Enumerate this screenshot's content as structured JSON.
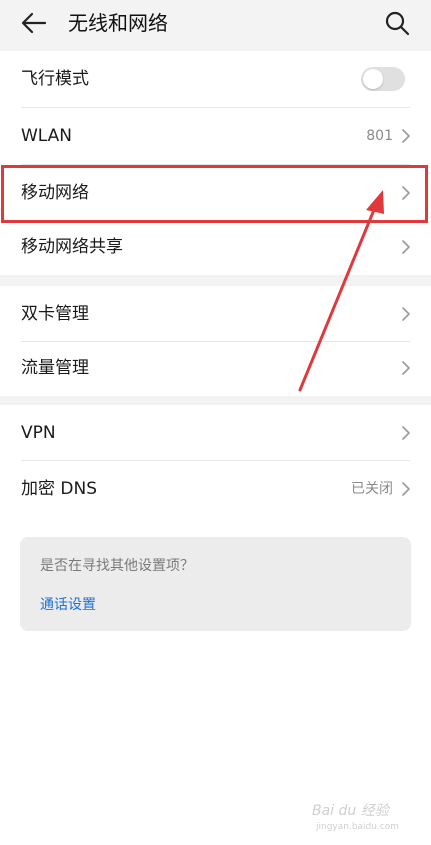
{
  "header": {
    "title": "无线和网络",
    "back_icon": "arrow-left-icon",
    "search_icon": "search-icon"
  },
  "groups": [
    {
      "rows": [
        {
          "label": "飞行模式",
          "type": "toggle",
          "toggle_on": false
        },
        {
          "label": "WLAN",
          "value": "801",
          "type": "chevron"
        },
        {
          "label": "移动网络",
          "type": "chevron",
          "highlighted": true
        },
        {
          "label": "移动网络共享",
          "type": "chevron"
        }
      ]
    },
    {
      "rows": [
        {
          "label": "双卡管理",
          "type": "chevron"
        },
        {
          "label": "流量管理",
          "type": "chevron"
        }
      ]
    },
    {
      "rows": [
        {
          "label": "VPN",
          "type": "chevron"
        },
        {
          "label": "加密 DNS",
          "value": "已关闭",
          "type": "chevron"
        }
      ]
    }
  ],
  "suggestion": {
    "question": "是否在寻找其他设置项？",
    "link": "通话设置"
  },
  "annotation": {
    "highlight_color": "#e0393c",
    "arrow_color": "#e0393c"
  },
  "watermark": {
    "text": "Bai du 经验",
    "sub": "jingyan.baidu.com"
  },
  "colors": {
    "background": "#f3f3f3",
    "card": "#ffffff",
    "link": "#1c6fd6",
    "secondary_text": "#8a8a8a"
  }
}
